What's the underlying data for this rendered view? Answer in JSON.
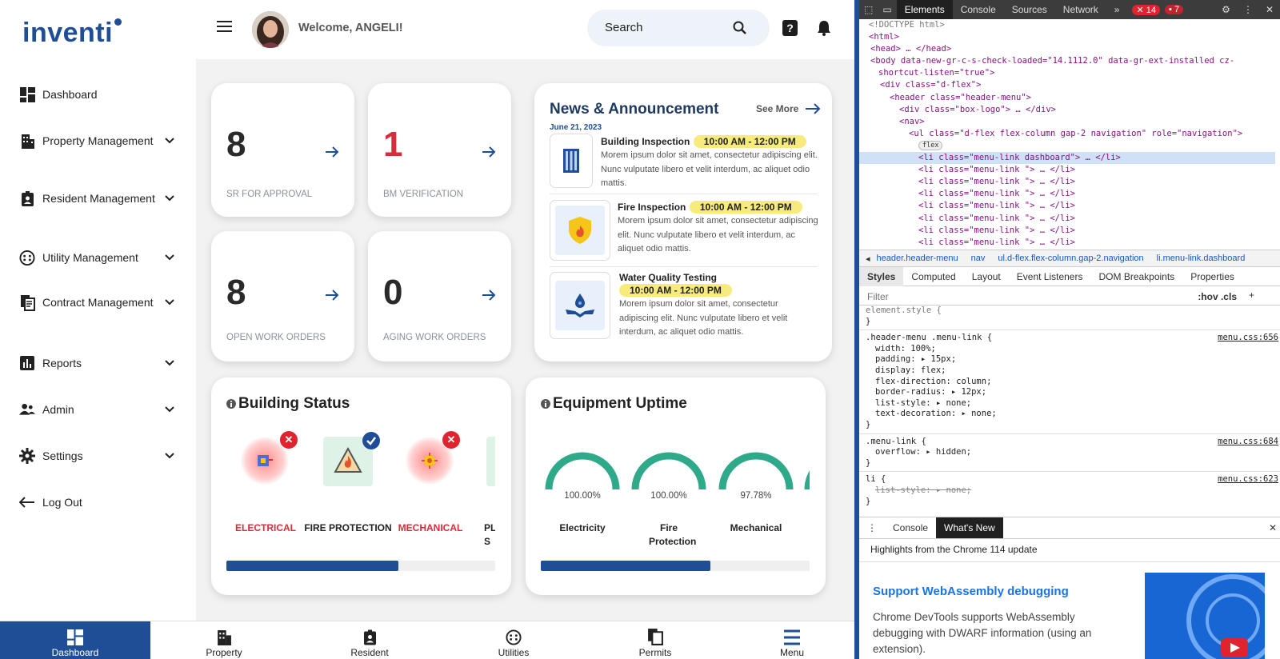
{
  "sidebar": {
    "logo": "inventi",
    "items": [
      {
        "label": "Dashboard",
        "icon": "dashboard-icon"
      },
      {
        "label": "Property Management",
        "icon": "building-icon"
      },
      {
        "label": "Resident Management",
        "icon": "resident-badge-icon"
      },
      {
        "label": "Utility Management",
        "icon": "utility-icon"
      },
      {
        "label": "Contract Management",
        "icon": "document-icon"
      },
      {
        "label": "Reports",
        "icon": "chart-icon"
      },
      {
        "label": "Admin",
        "icon": "users-icon"
      },
      {
        "label": "Settings",
        "icon": "gear-icon"
      },
      {
        "label": "Log Out",
        "icon": "logout-arrow-icon"
      }
    ]
  },
  "header": {
    "welcome": "Welcome, ANGELI!",
    "search_placeholder": "Search"
  },
  "stats": [
    {
      "value": "8",
      "label": "SR FOR APPROVAL",
      "color": "#2a2a2a"
    },
    {
      "value": "1",
      "label": "BM VERIFICATION",
      "color": "#d92c3a"
    },
    {
      "value": "8",
      "label": "OPEN WORK ORDERS",
      "color": "#2a2a2a"
    },
    {
      "value": "0",
      "label": "AGING WORK ORDERS",
      "color": "#2a2a2a"
    }
  ],
  "news": {
    "title": "News & Announcement",
    "see_more": "See More",
    "date": "June 21, 2023",
    "items": [
      {
        "title": "Building Inspection",
        "time": "10:00 AM - 12:00 PM",
        "text": "Morem ipsum dolor sit amet, consectetur adipiscing elit. Nunc vulputate libero et velit interdum, ac aliquet odio mattis."
      },
      {
        "title": "Fire Inspection",
        "time": "10:00 AM - 12:00 PM",
        "text": "Morem ipsum dolor sit amet, consectetur adipiscing elit. Nunc vulputate libero et velit interdum, ac aliquet odio mattis."
      },
      {
        "title": "Water Quality Testing",
        "time": "10:00 AM - 12:00 PM",
        "text": "Morem ipsum dolor sit amet, consectetur adipiscing elit. Nunc vulputate libero et velit interdum, ac aliquet odio mattis."
      }
    ]
  },
  "building_status": {
    "title": "Building Status",
    "items": [
      {
        "label": "ELECTRICAL",
        "status": "error"
      },
      {
        "label": "FIRE PROTECTION",
        "status": "ok"
      },
      {
        "label": "MECHANICAL",
        "status": "error"
      },
      {
        "label": "PL S",
        "status": "ok"
      }
    ],
    "scroll_progress": 0.64
  },
  "equipment_uptime": {
    "title": "Equipment Uptime",
    "items": [
      {
        "pct": "100.00%",
        "label": "Electricity",
        "value": 100
      },
      {
        "pct": "100.00%",
        "label": "Fire Protection",
        "value": 100
      },
      {
        "pct": "97.78%",
        "label": "Mechanical",
        "value": 97.78
      }
    ],
    "scroll_progress": 0.63
  },
  "bottom_nav": [
    {
      "label": "Dashboard",
      "active": true
    },
    {
      "label": "Property"
    },
    {
      "label": "Resident"
    },
    {
      "label": "Utilities"
    },
    {
      "label": "Permits"
    },
    {
      "label": "Menu"
    }
  ],
  "devtools": {
    "tabs": [
      "Elements",
      "Console",
      "Sources",
      "Network"
    ],
    "errors": "14",
    "warnings": "7",
    "code_lines": [
      "<!DOCTYPE html>",
      "<html>",
      "<head> … </head>",
      "<body data-new-gr-c-s-check-loaded=\"14.1112.0\" data-gr-ext-installed cz-",
      "shortcut-listen=\"true\">",
      "<div class=\"d-flex\">",
      "<header class=\"header-menu\">",
      "<div class=\"box-logo\"> … </div>",
      "<nav>",
      "<ul class=\"d-flex flex-column gap-2 navigation\" role=\"navigation\">",
      "flex",
      "<li class=\"menu-link dashboard\"> … </li>",
      "<li class=\"menu-link  \"> … </li>",
      "<li class=\"menu-link  \"> … </li>",
      "<li class=\"menu-link  \"> … </li>",
      "<li class=\"menu-link  \"> … </li>",
      "<li class=\"menu-link  \"> … </li>",
      "<li class=\"menu-link  \"> … </li>",
      "<li class=\"menu-link  \"> … </li>"
    ],
    "breadcrumbs": [
      "header.header-menu",
      "nav",
      "ul.d-flex.flex-column.gap-2.navigation",
      "li.menu-link.dashboard"
    ],
    "style_tabs": [
      "Styles",
      "Computed",
      "Layout",
      "Event Listeners",
      "DOM Breakpoints",
      "Properties"
    ],
    "filter_placeholder": "Filter",
    "filter_tools": ":hov .cls",
    "rules": [
      {
        "sel": "element.style {",
        "src": "",
        "props": []
      },
      {
        "sel": ".header-menu .menu-link {",
        "src": "menu.css:656",
        "props": [
          "width: 100%;",
          "padding: ▸ 15px;",
          "display: flex;",
          "flex-direction: column;",
          "border-radius: ▸ 12px;",
          "list-style: ▸ none;",
          "text-decoration: ▸ none;"
        ]
      },
      {
        "sel": ".menu-link {",
        "src": "menu.css:684",
        "props": [
          "overflow: ▸ hidden;"
        ]
      },
      {
        "sel": "li {",
        "src": "menu.css:623",
        "props": [
          "list-style: ▸ none;"
        ]
      }
    ],
    "drawer_tabs": [
      "Console",
      "What's New"
    ],
    "highlights": "Highlights from the Chrome 114 update",
    "news_title": "Support WebAssembly debugging",
    "news_body": "Chrome DevTools supports WebAssembly debugging with DWARF information (using an extension)."
  }
}
